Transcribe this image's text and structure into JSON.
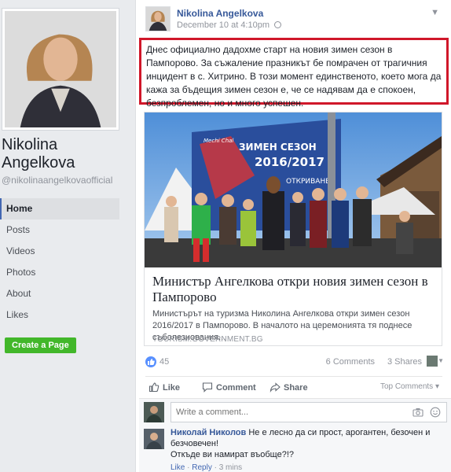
{
  "sidebar": {
    "page_name": "Nikolina Angelkova",
    "handle": "@nikolinaangelkovaofficial",
    "nav": [
      "Home",
      "Posts",
      "Videos",
      "Photos",
      "About",
      "Likes"
    ],
    "active_nav": "Home",
    "create_page_label": "Create a Page"
  },
  "post": {
    "author": "Nikolina Angelkova",
    "timestamp": "December 10 at 4:10pm",
    "text": "Днес официално дадохме старт на новия зимен сезон в Пампорово. За съжаление празникът бе помрачен от трагичния инцидент в с. Хитрино. В този момент единственото, което мога да кажа за бъдещия зимен сезон е, че се надявам да е спокоен, безпроблемен, но и много успешен.",
    "link": {
      "banner_text": [
        "ЗИМЕН СЕЗОН",
        "2016/2017",
        "ОТКРИВАНЕ",
        "Mechi Chal"
      ],
      "title": "Министър Ангелкова откри новия зимен сезон в Пампорово",
      "description": "Министърът на туризма Николина Ангелкова откри зимен сезон 2016/2017 в Пампорово. В началото на церемонията тя поднесе съболезнования...",
      "domain": "TOURISM.GOVERNMENT.BG"
    },
    "likes": "45",
    "comments_count": "6 Comments",
    "shares_count": "3 Shares",
    "actions": {
      "like": "Like",
      "comment": "Comment",
      "share": "Share"
    },
    "top_comments": "Top Comments",
    "comment_placeholder": "Write a comment...",
    "comment": {
      "author": "Николай Николов",
      "text": "Не е лесно да си прост, арогантен, безочен и безчовечен!",
      "text2": "Откъде ви намират въобще?!?",
      "like": "Like",
      "reply": "Reply",
      "time": "3 mins"
    }
  },
  "colors": {
    "accent": "#4267b2",
    "link": "#365899",
    "highlight_border": "#d0172a",
    "cta": "#42b72a"
  }
}
